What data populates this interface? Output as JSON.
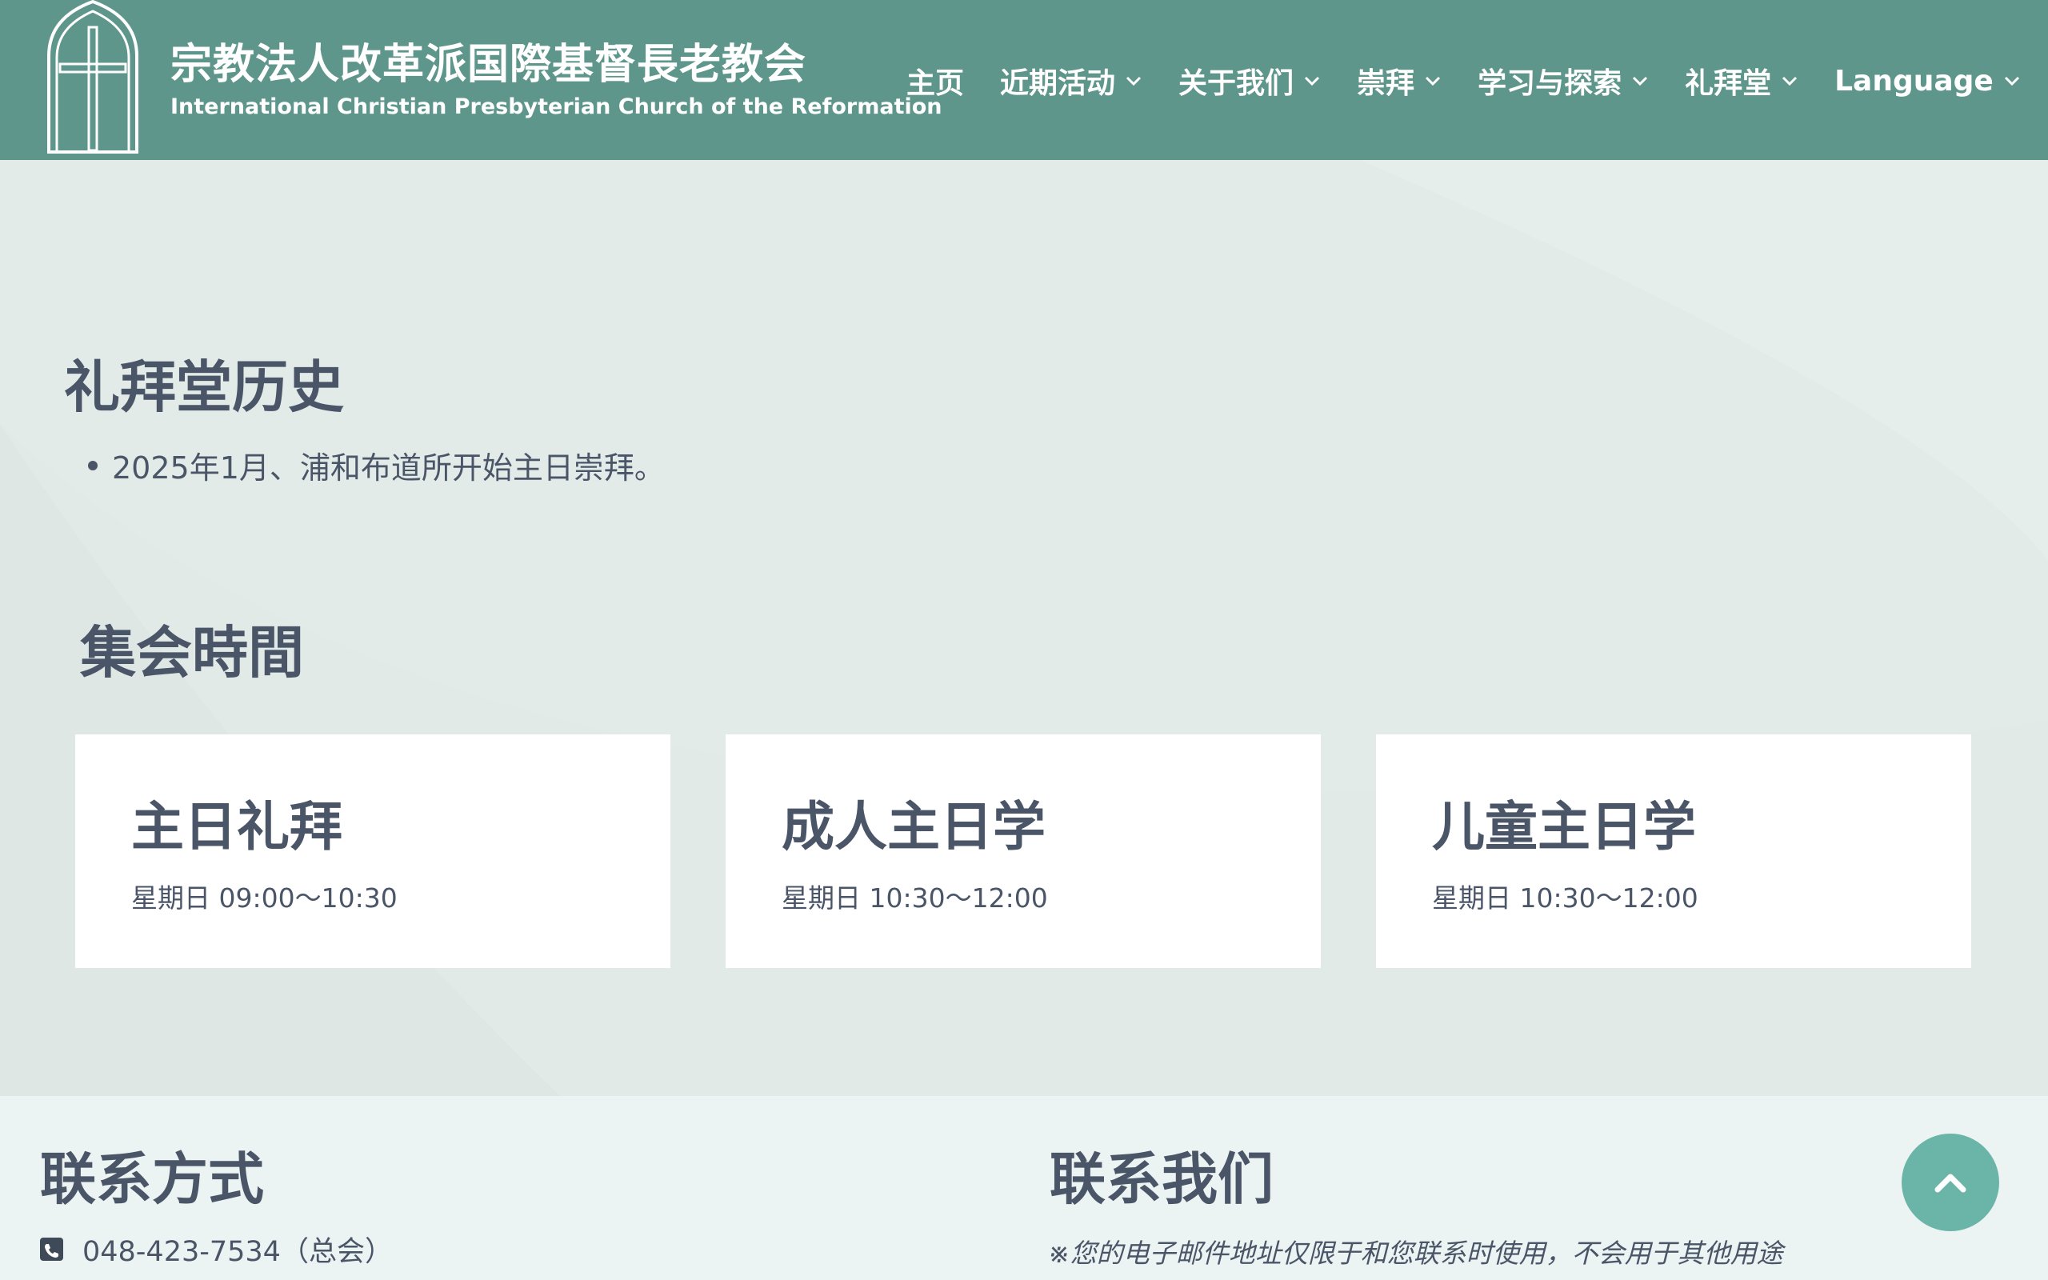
{
  "header": {
    "title": "宗教法人改革派国際基督長老教会",
    "subtitle": "International Christian Presbyterian Church of the Reformation",
    "logo_icon": "church-cross-icon"
  },
  "nav": {
    "items": [
      {
        "label": "主页",
        "has_dropdown": false
      },
      {
        "label": "近期活动",
        "has_dropdown": true
      },
      {
        "label": "关于我们",
        "has_dropdown": true
      },
      {
        "label": "崇拜",
        "has_dropdown": true
      },
      {
        "label": "学习与探索",
        "has_dropdown": true
      },
      {
        "label": "礼拜堂",
        "has_dropdown": true
      },
      {
        "label": "Language",
        "has_dropdown": true
      }
    ]
  },
  "history": {
    "heading": "礼拜堂历史",
    "items": [
      "2025年1月、浦和布道所开始主日崇拜。"
    ]
  },
  "meetings": {
    "heading": "集会時間",
    "cards": [
      {
        "title": "主日礼拜",
        "time": "星期日 09:00～10:30"
      },
      {
        "title": "成人主日学",
        "time": "星期日 10:30～12:00"
      },
      {
        "title": "儿童主日学",
        "time": "星期日 10:30～12:00"
      }
    ]
  },
  "footer": {
    "contact_heading": "联系方式",
    "phone": "048-423-7534（总会）",
    "contact_us_heading": "联系我们",
    "note": "※您的电子邮件地址仅限于和您联系时使用，不会用于其他用途"
  },
  "colors": {
    "header_bg": "#5e968b",
    "text": "#4a5568",
    "accent": "#6bb5a8"
  },
  "icons": {
    "phone": "phone-icon",
    "back_to_top": "chevron-up-icon",
    "dropdown": "chevron-down-icon"
  }
}
